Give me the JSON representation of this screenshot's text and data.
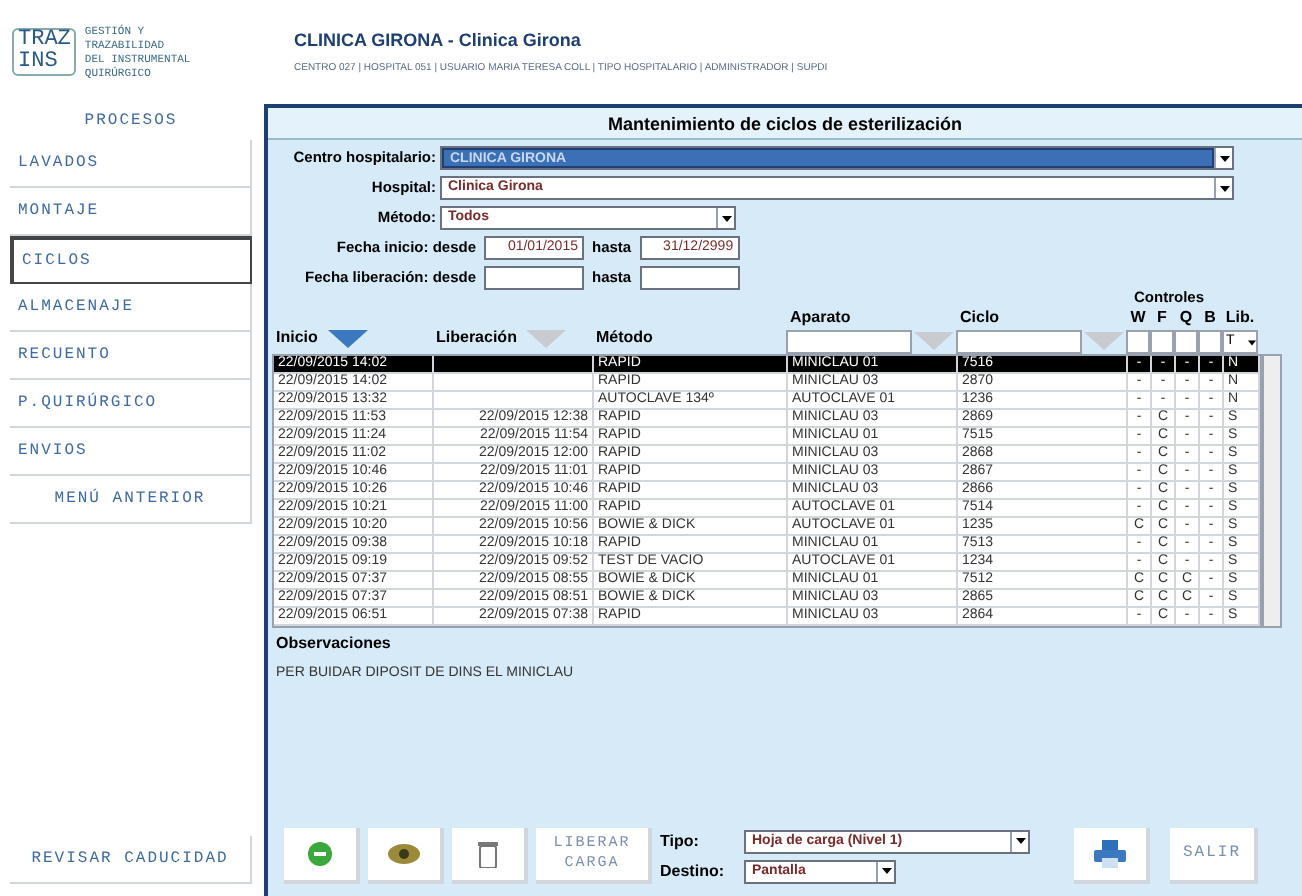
{
  "logo": {
    "line1": "TRAZ",
    "line2": "INS",
    "tagline": [
      "GESTIÓN Y",
      "TRAZABILIDAD",
      "DEL INSTRUMENTAL",
      "QUIRÚRGICO"
    ]
  },
  "header": {
    "title": "CLINICA GIRONA - Clinica Girona",
    "subtitle": "CENTRO 027 | HOSPITAL 051 | USUARIO MARIA TERESA COLL | TIPO HOSPITALARIO | ADMINISTRADOR | SUPDI"
  },
  "sidebar": {
    "heading": "PROCESOS",
    "items": [
      {
        "label": "LAVADOS",
        "selected": false
      },
      {
        "label": "MONTAJE",
        "selected": false
      },
      {
        "label": "CICLOS",
        "selected": true
      },
      {
        "label": "ALMACENAJE",
        "selected": false
      },
      {
        "label": "RECUENTO",
        "selected": false
      },
      {
        "label": "P.QUIRÚRGICO",
        "selected": false
      },
      {
        "label": "ENVIOS",
        "selected": false
      }
    ],
    "back": "MENÚ ANTERIOR",
    "footer_button": "REVISAR CADUCIDAD"
  },
  "form": {
    "title": "Mantenimiento de ciclos de esterilización",
    "centro": {
      "label": "Centro hospitalario:",
      "value": "CLINICA GIRONA"
    },
    "hospital": {
      "label": "Hospital:",
      "value": "Clinica Girona"
    },
    "metodo": {
      "label": "Método:",
      "value": "Todos"
    },
    "fecha_inicio": {
      "label": "Fecha inicio: desde",
      "from": "01/01/2015",
      "to_label": "hasta",
      "to": "31/12/2999"
    },
    "fecha_liberacion": {
      "label": "Fecha liberación: desde",
      "to_label": "hasta"
    }
  },
  "table": {
    "controls_label": "Controles",
    "columns": [
      {
        "label": "Inicio",
        "kind": "sort",
        "sort_active": true
      },
      {
        "label": "Liberación",
        "kind": "sort",
        "sort_active": false
      },
      {
        "label": "Método",
        "kind": "plain"
      },
      {
        "label": "Aparato",
        "kind": "filter",
        "sort_active": false
      },
      {
        "label": "Ciclo",
        "kind": "filter",
        "sort_active": false
      },
      {
        "label": "W",
        "kind": "control"
      },
      {
        "label": "F",
        "kind": "control"
      },
      {
        "label": "Q",
        "kind": "control"
      },
      {
        "label": "B",
        "kind": "control"
      },
      {
        "label": "Lib.",
        "kind": "select",
        "value": "T"
      }
    ],
    "rows": [
      {
        "inicio": "22/09/2015 14:02",
        "liberacion": "",
        "metodo": "RAPID",
        "aparato": "MINICLAU 01",
        "ciclo": "7516",
        "w": "-",
        "f": "-",
        "q": "-",
        "b": "-",
        "lib": "N",
        "selected": true
      },
      {
        "inicio": "22/09/2015 14:02",
        "liberacion": "",
        "metodo": "RAPID",
        "aparato": "MINICLAU 03",
        "ciclo": "2870",
        "w": "-",
        "f": "-",
        "q": "-",
        "b": "-",
        "lib": "N",
        "selected": false
      },
      {
        "inicio": "22/09/2015 13:32",
        "liberacion": "",
        "metodo": "AUTOCLAVE 134º",
        "aparato": "AUTOCLAVE 01",
        "ciclo": "1236",
        "w": "-",
        "f": "-",
        "q": "-",
        "b": "-",
        "lib": "N",
        "selected": false
      },
      {
        "inicio": "22/09/2015 11:53",
        "liberacion": "22/09/2015 12:38",
        "metodo": "RAPID",
        "aparato": "MINICLAU 03",
        "ciclo": "2869",
        "w": "-",
        "f": "C",
        "q": "-",
        "b": "-",
        "lib": "S",
        "selected": false
      },
      {
        "inicio": "22/09/2015 11:24",
        "liberacion": "22/09/2015 11:54",
        "metodo": "RAPID",
        "aparato": "MINICLAU 01",
        "ciclo": "7515",
        "w": "-",
        "f": "C",
        "q": "-",
        "b": "-",
        "lib": "S",
        "selected": false
      },
      {
        "inicio": "22/09/2015 11:02",
        "liberacion": "22/09/2015 12:00",
        "metodo": "RAPID",
        "aparato": "MINICLAU 03",
        "ciclo": "2868",
        "w": "-",
        "f": "C",
        "q": "-",
        "b": "-",
        "lib": "S",
        "selected": false
      },
      {
        "inicio": "22/09/2015 10:46",
        "liberacion": "22/09/2015 11:01",
        "metodo": "RAPID",
        "aparato": "MINICLAU 03",
        "ciclo": "2867",
        "w": "-",
        "f": "C",
        "q": "-",
        "b": "-",
        "lib": "S",
        "selected": false
      },
      {
        "inicio": "22/09/2015 10:26",
        "liberacion": "22/09/2015 10:46",
        "metodo": "RAPID",
        "aparato": "MINICLAU 03",
        "ciclo": "2866",
        "w": "-",
        "f": "C",
        "q": "-",
        "b": "-",
        "lib": "S",
        "selected": false
      },
      {
        "inicio": "22/09/2015 10:21",
        "liberacion": "22/09/2015 11:00",
        "metodo": "RAPID",
        "aparato": "AUTOCLAVE 01",
        "ciclo": "7514",
        "w": "-",
        "f": "C",
        "q": "-",
        "b": "-",
        "lib": "S",
        "selected": false
      },
      {
        "inicio": "22/09/2015 10:20",
        "liberacion": "22/09/2015 10:56",
        "metodo": "BOWIE & DICK",
        "aparato": "AUTOCLAVE 01",
        "ciclo": "1235",
        "w": "C",
        "f": "C",
        "q": "-",
        "b": "-",
        "lib": "S",
        "selected": false
      },
      {
        "inicio": "22/09/2015 09:38",
        "liberacion": "22/09/2015 10:18",
        "metodo": "RAPID",
        "aparato": "MINICLAU 01",
        "ciclo": "7513",
        "w": "-",
        "f": "C",
        "q": "-",
        "b": "-",
        "lib": "S",
        "selected": false
      },
      {
        "inicio": "22/09/2015 09:19",
        "liberacion": "22/09/2015 09:52",
        "metodo": "TEST DE VACIO",
        "aparato": "AUTOCLAVE 01",
        "ciclo": "1234",
        "w": "-",
        "f": "C",
        "q": "-",
        "b": "-",
        "lib": "S",
        "selected": false
      },
      {
        "inicio": "22/09/2015 07:37",
        "liberacion": "22/09/2015 08:55",
        "metodo": "BOWIE & DICK",
        "aparato": "MINICLAU 01",
        "ciclo": "7512",
        "w": "C",
        "f": "C",
        "q": "C",
        "b": "-",
        "lib": "S",
        "selected": false
      },
      {
        "inicio": "22/09/2015 07:37",
        "liberacion": "22/09/2015 08:51",
        "metodo": "BOWIE & DICK",
        "aparato": "MINICLAU 03",
        "ciclo": "2865",
        "w": "C",
        "f": "C",
        "q": "C",
        "b": "-",
        "lib": "S",
        "selected": false
      },
      {
        "inicio": "22/09/2015 06:51",
        "liberacion": "22/09/2015 07:38",
        "metodo": "RAPID",
        "aparato": "MINICLAU 03",
        "ciclo": "2864",
        "w": "-",
        "f": "C",
        "q": "-",
        "b": "-",
        "lib": "S",
        "selected": false
      }
    ]
  },
  "observaciones": {
    "label": "Observaciones",
    "text": "PER BUIDAR DIPOSIT DE DINS EL MINICLAU"
  },
  "actions": {
    "liberar": "LIBERAR CARGA",
    "tipo": {
      "label": "Tipo:",
      "value": "Hoja de carga (Nivel 1)"
    },
    "destino": {
      "label": "Destino:",
      "value": "Pantalla"
    },
    "salir": "SALIR"
  }
}
